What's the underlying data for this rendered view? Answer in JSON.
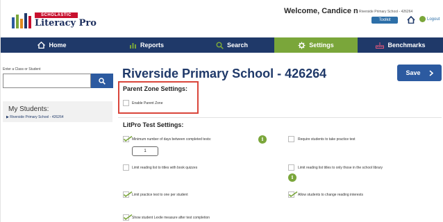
{
  "header": {
    "brand": "SCHOLASTIC",
    "app_name": "Literacy Pro",
    "welcome": "Welcome, Candice n",
    "school_short": "Riverside Primary School - 426264",
    "toolkit_label": "Toolkit",
    "logout_label": "Logout"
  },
  "nav": {
    "items": [
      {
        "label": "Home",
        "icon": "home-icon"
      },
      {
        "label": "Reports",
        "icon": "bar-chart-icon"
      },
      {
        "label": "Search",
        "icon": "search-icon"
      },
      {
        "label": "Settings",
        "icon": "gear-icon",
        "active": true
      },
      {
        "label": "Benchmarks",
        "icon": "ruler-icon"
      }
    ]
  },
  "sidebar": {
    "search_label": "Enter a Class or Student",
    "search_value": "",
    "my_students_title": "My Students:",
    "my_students_item": "Riverside Primary School - 426264"
  },
  "main": {
    "title": "Riverside Primary School - 426264",
    "save_label": "Save",
    "parent_zone_title": "Parent Zone Settings:",
    "enable_parent_zone": {
      "label": "Enable Parent Zone",
      "checked": false
    },
    "test_settings_title": "LitPro Test Settings:",
    "min_days": {
      "label": "Minimum number of days between completed tests:",
      "checked": true,
      "value": "1"
    },
    "practice_test": {
      "label": "Require students to take practice test",
      "checked": false
    },
    "limit_quizzes": {
      "label": "Limit reading list to titles with book quizzes",
      "checked": false
    },
    "limit_library": {
      "label": "Limit reading list titles to only those in the school library",
      "checked": false
    },
    "limit_practice": {
      "label": "Limit practice test to one per student",
      "checked": true
    },
    "allow_interests": {
      "label": "Allow students to change reading interests",
      "checked": true
    },
    "show_lexile": {
      "label": "Show student Lexile measure after test completion",
      "checked": true
    }
  },
  "colors": {
    "navy": "#1f3969",
    "green": "#7aa63a",
    "button_blue": "#2c5aa0",
    "highlight_red": "#d9453a",
    "brand_red": "#c8102e"
  }
}
